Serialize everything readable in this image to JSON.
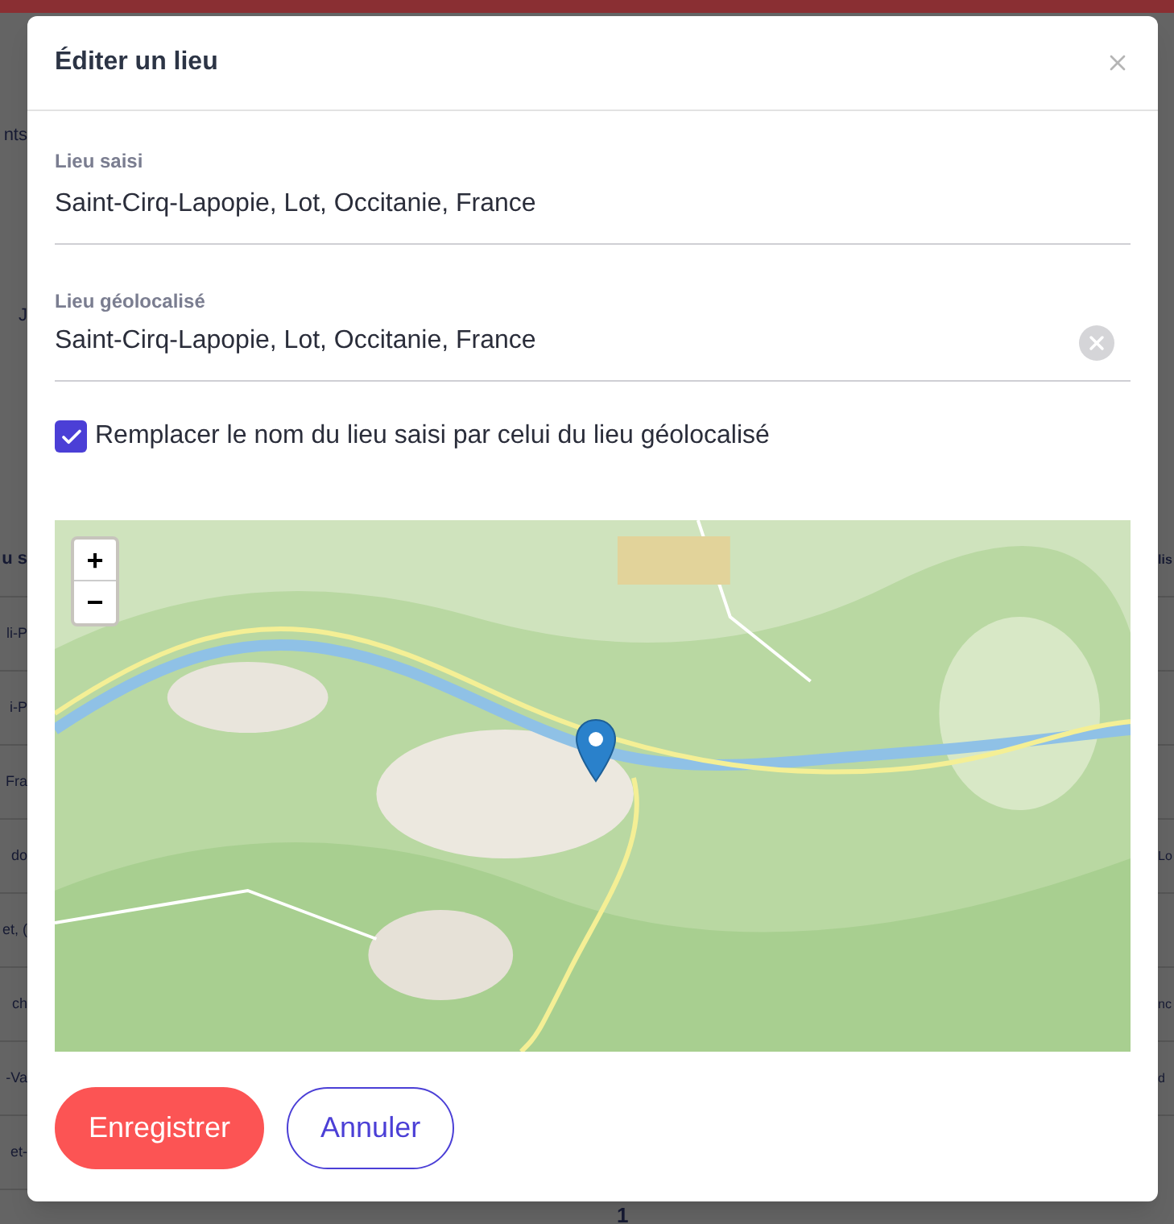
{
  "backdrop": {
    "left_fragments": [
      {
        "kind": "text",
        "text": "nts"
      },
      {
        "kind": "text",
        "text": "J"
      },
      {
        "kind": "header",
        "text": "u s"
      },
      {
        "kind": "row",
        "text": "li-P"
      },
      {
        "kind": "row",
        "text": "i-P"
      },
      {
        "kind": "row",
        "text": "Fra"
      },
      {
        "kind": "row",
        "text": "do"
      },
      {
        "kind": "row",
        "text": "et, ("
      },
      {
        "kind": "row",
        "text": "ch"
      },
      {
        "kind": "row",
        "text": "-Va"
      },
      {
        "kind": "row",
        "text": "et-"
      }
    ],
    "right_fragments": [
      {
        "kind": "header",
        "text": "lis"
      },
      {
        "kind": "row"
      },
      {
        "kind": "row"
      },
      {
        "kind": "row"
      },
      {
        "kind": "row",
        "text": "Lo"
      },
      {
        "kind": "row"
      },
      {
        "kind": "row",
        "text": "nc"
      },
      {
        "kind": "row",
        "text": "d"
      }
    ],
    "page_number": "1"
  },
  "dialog": {
    "title": "Éditer un lieu",
    "entered_place": {
      "label": "Lieu saisi",
      "value": "Saint-Cirq-Lapopie, Lot, Occitanie, France"
    },
    "geolocated_place": {
      "label": "Lieu géolocalisé",
      "value": "Saint-Cirq-Lapopie, Lot, Occitanie, France"
    },
    "replace_name": {
      "label": "Remplacer le nom du lieu saisi par celui du lieu géolocalisé",
      "checked": true
    },
    "map": {
      "kind": "picture",
      "zoom_in": "+",
      "zoom_out": "−"
    },
    "buttons": [
      {
        "label": "Enregistrer",
        "kind": "primary"
      },
      {
        "label": "Annuler",
        "kind": "secondary"
      }
    ]
  }
}
